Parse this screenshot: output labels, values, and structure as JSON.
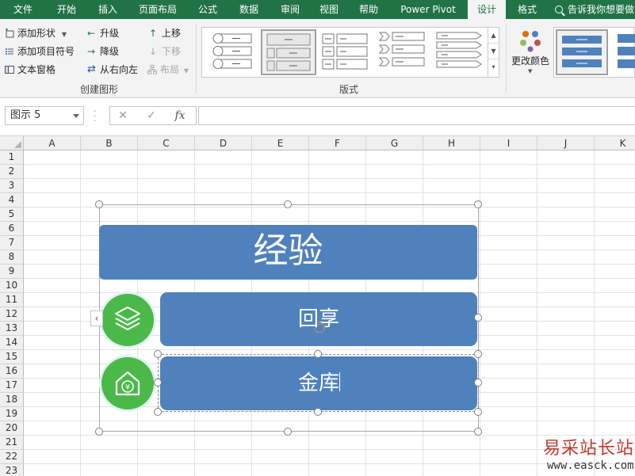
{
  "tabs": [
    {
      "label": "文件",
      "active": false
    },
    {
      "label": "开始",
      "active": false
    },
    {
      "label": "插入",
      "active": false
    },
    {
      "label": "页面布局",
      "active": false
    },
    {
      "label": "公式",
      "active": false
    },
    {
      "label": "数据",
      "active": false
    },
    {
      "label": "审阅",
      "active": false
    },
    {
      "label": "视图",
      "active": false
    },
    {
      "label": "帮助",
      "active": false
    },
    {
      "label": "Power Pivot",
      "active": false
    },
    {
      "label": "设计",
      "active": true
    },
    {
      "label": "格式",
      "active": false
    }
  ],
  "tell_me": "告诉我你想要做",
  "ribbon": {
    "create_group": {
      "label": "创建图形",
      "add_shape": "添加形状",
      "add_bullet": "添加项目符号",
      "text_pane": "文本窗格",
      "promote": "升级",
      "demote": "降级",
      "right_to_left": "从右向左",
      "move_up": "上移",
      "move_down": "下移",
      "layout": "布局"
    },
    "layouts_group": {
      "label": "版式"
    },
    "change_colors": "更改颜色"
  },
  "formula_bar": {
    "name_box": "图示 5",
    "fx": "fx"
  },
  "columns": [
    "A",
    "B",
    "C",
    "D",
    "E",
    "F",
    "G",
    "H",
    "I",
    "J",
    "K"
  ],
  "rows": [
    "1",
    "2",
    "3",
    "4",
    "5",
    "6",
    "7",
    "8",
    "9",
    "10",
    "11",
    "12",
    "13",
    "14",
    "15",
    "16",
    "17",
    "18",
    "19",
    "20",
    "21",
    "22",
    "23"
  ],
  "smartart": {
    "title": "经验",
    "items": [
      {
        "text": "回享",
        "icon": "layers-icon"
      },
      {
        "text": "金库",
        "icon": "house-yen-icon"
      }
    ],
    "colors": {
      "box": "#4f81bd",
      "circle": "#4ab94a"
    }
  },
  "watermark": {
    "text": "易采站长站",
    "url": "www.easck.com"
  },
  "colors": {
    "ribbon_green": "#217346"
  }
}
